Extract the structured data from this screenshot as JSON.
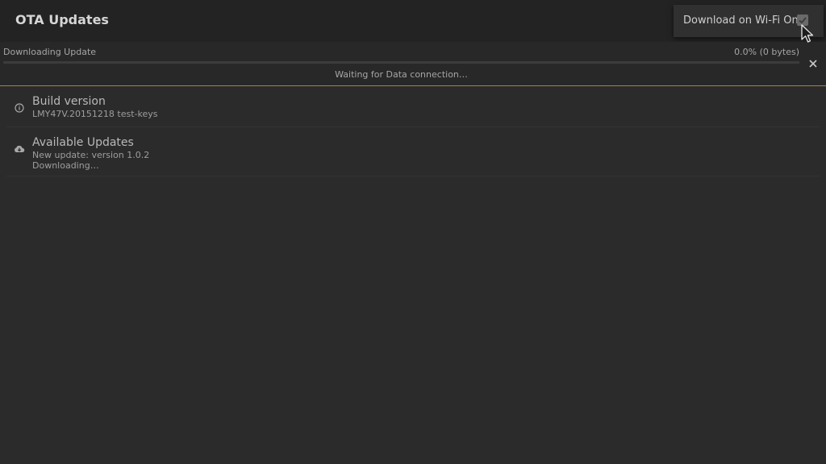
{
  "app": {
    "title": "OTA Updates"
  },
  "menu": {
    "wifi_only_label": "Download on Wi-Fi Only",
    "wifi_only_checked": true
  },
  "download": {
    "label": "Downloading Update",
    "percent_text": "0.0% (0 bytes)",
    "progress": 0.0,
    "status": "Waiting for Data connection…"
  },
  "items": [
    {
      "icon": "info-icon",
      "title": "Build version",
      "subtitle": "LMY47V.20151218 test-keys"
    },
    {
      "icon": "cloud-download-icon",
      "title": "Available Updates",
      "subtitle": "New update: version 1.0.2",
      "subtitle2": "Downloading…"
    }
  ],
  "colors": {
    "background": "#2b2b2b",
    "toolbar": "#232323",
    "accent": "#a7823f"
  }
}
